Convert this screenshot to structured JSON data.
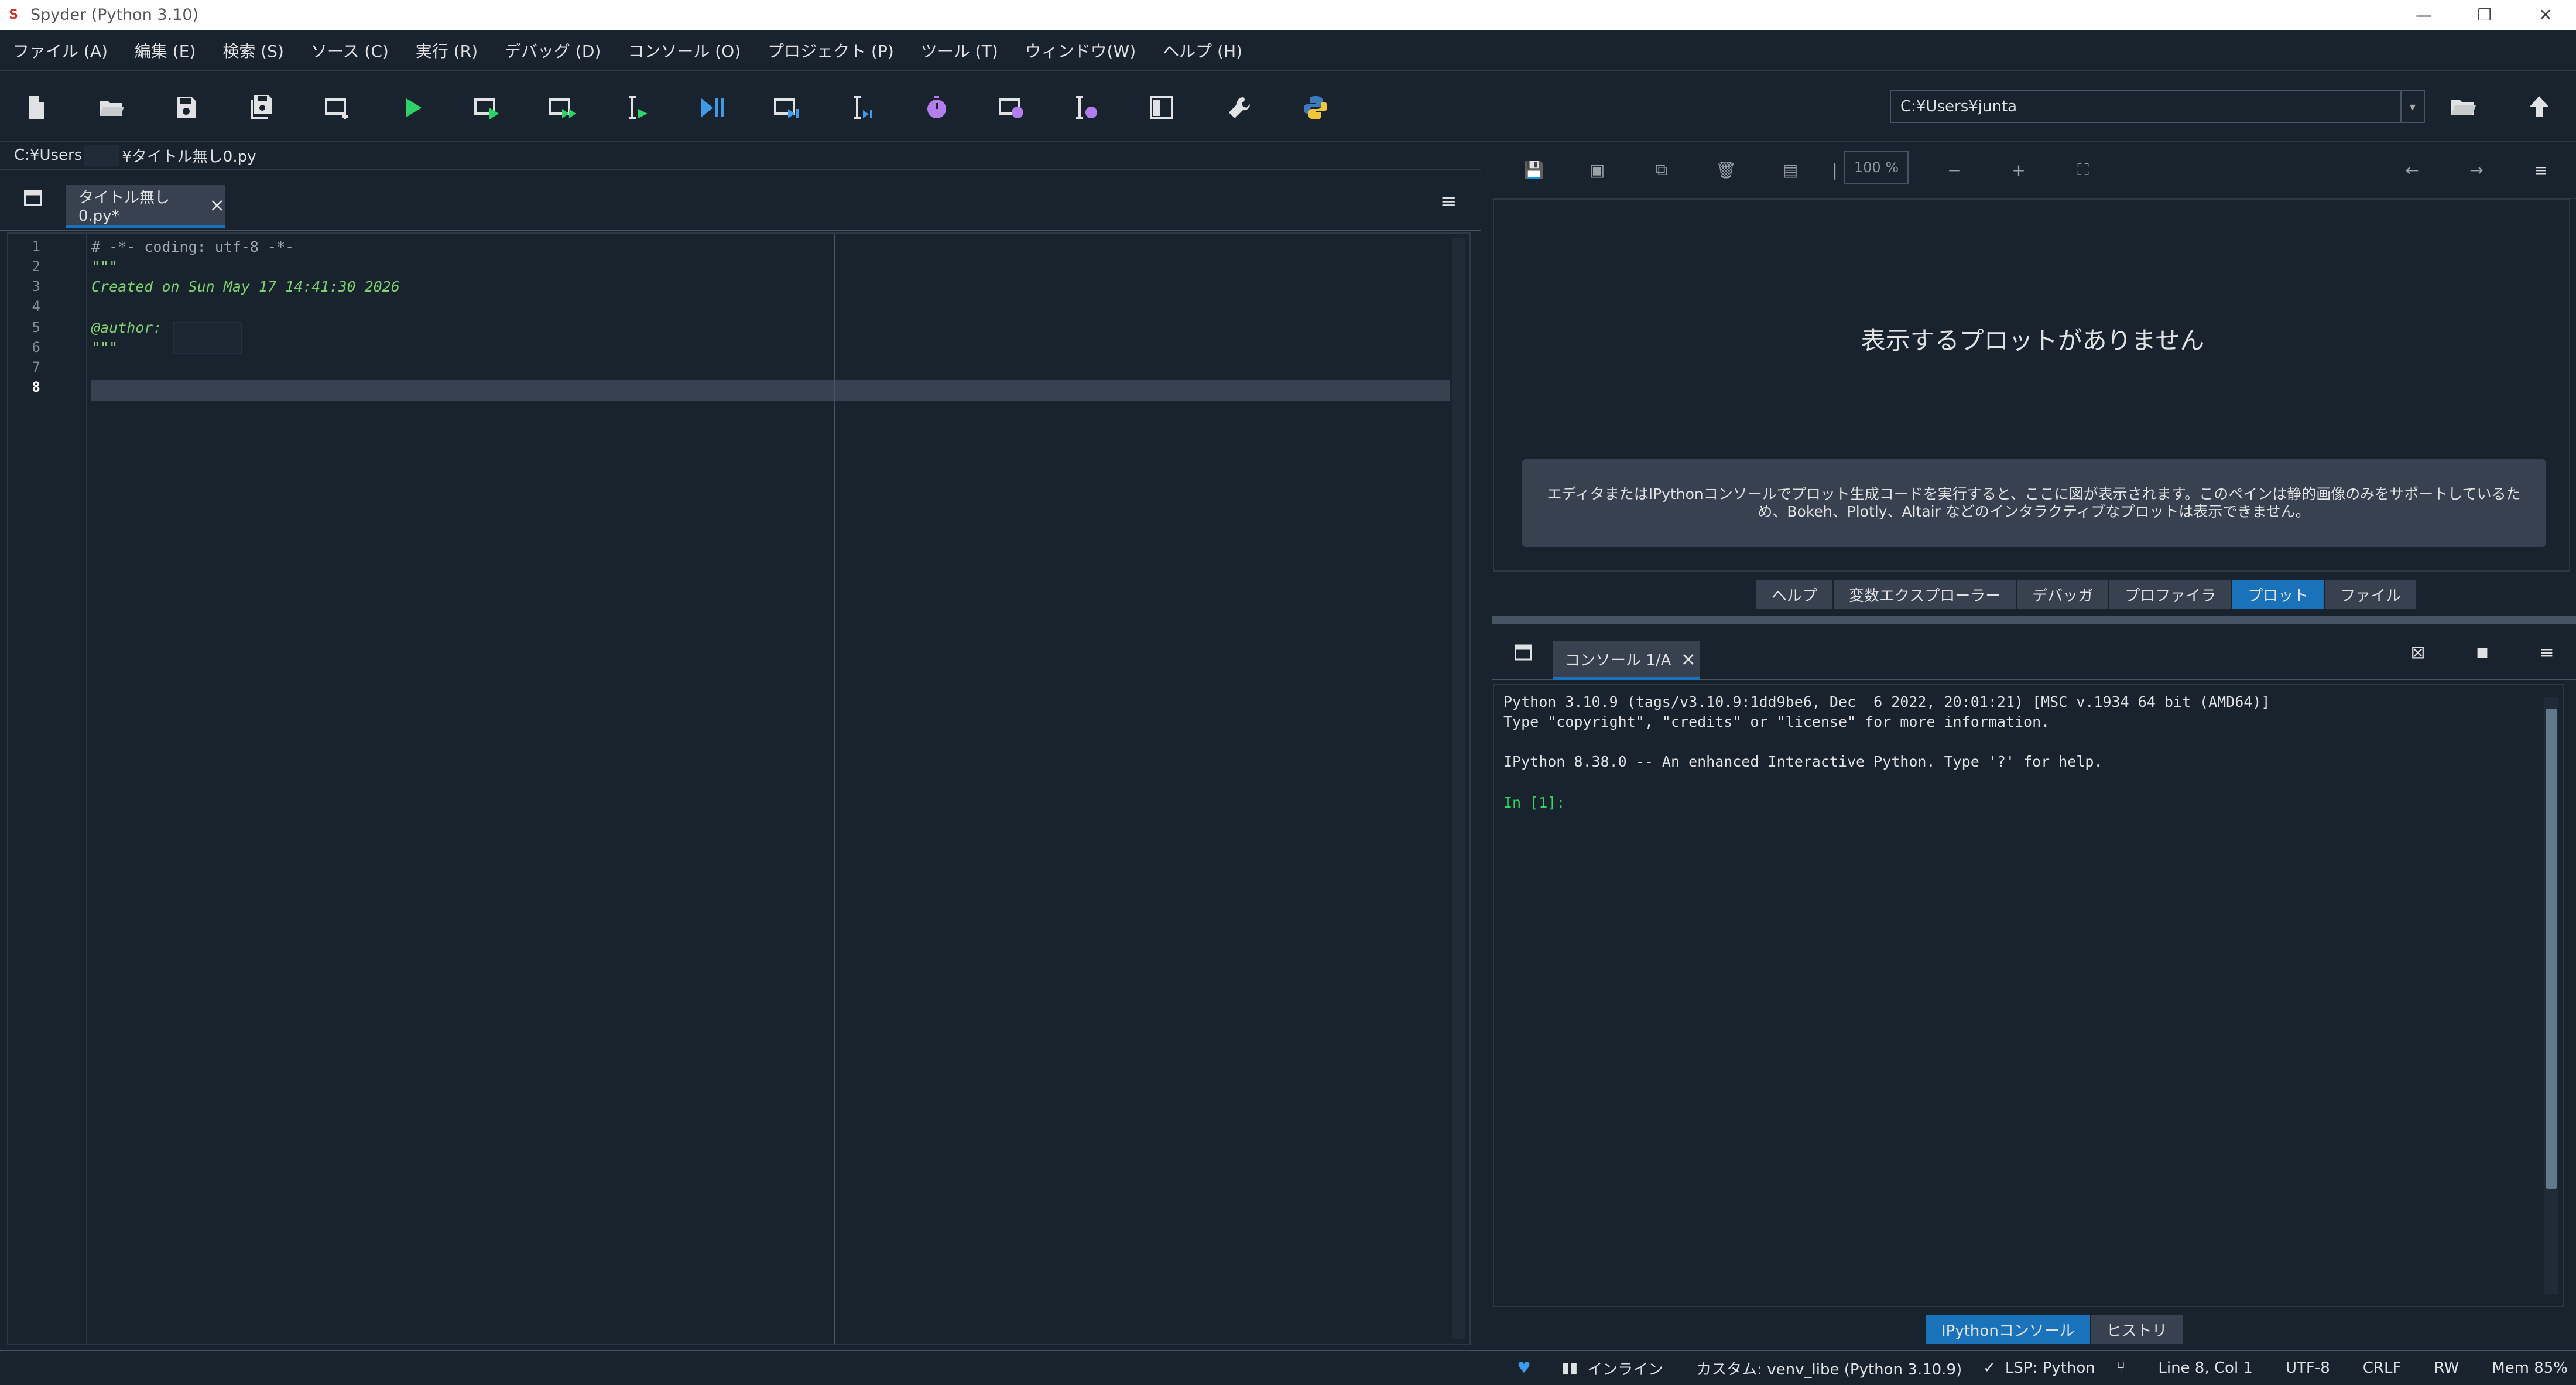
{
  "window": {
    "title": "Spyder (Python 3.10)",
    "app_icon": "spyder-icon"
  },
  "menu": [
    "ファイル (A)",
    "編集 (E)",
    "検索 (S)",
    "ソース (C)",
    "実行 (R)",
    "デバッグ (D)",
    "コンソール (O)",
    "プロジェクト (P)",
    "ツール (T)",
    "ウィンドウ(W)",
    "ヘルプ (H)"
  ],
  "toolbar": {
    "working_dir": "C:¥Users¥junta",
    "icons": [
      "new-file-icon",
      "open-file-icon",
      "save-icon",
      "save-all-icon",
      "new-cell-icon",
      "run-icon",
      "run-cell-icon",
      "run-cell-advance-icon",
      "run-selection-icon",
      "debug-icon",
      "debug-cell-icon",
      "debug-selection-icon",
      "profile-icon",
      "profile-cell-icon",
      "profile-selection-icon",
      "maximize-pane-icon",
      "preferences-icon",
      "python-path-icon"
    ]
  },
  "editor": {
    "breadcrumb_left": "C:¥Users",
    "breadcrumb_right": "¥タイトル無し0.py",
    "tab_label": "タイトル無し0.py*",
    "lines": [
      {
        "num": "1",
        "text": "# -*- coding: utf-8 -*-"
      },
      {
        "num": "2",
        "text": "\"\"\""
      },
      {
        "num": "3",
        "text": "Created on Sun May 17 14:41:30 2026"
      },
      {
        "num": "4",
        "text": ""
      },
      {
        "num": "5",
        "text": "@author:"
      },
      {
        "num": "6",
        "text": "\"\"\""
      },
      {
        "num": "7",
        "text": ""
      },
      {
        "num": "8",
        "text": ""
      }
    ]
  },
  "plots": {
    "zoom": "100 %",
    "empty_title": "表示するプロットがありません",
    "hint": "エディタまたはIPythonコンソールでプロット生成コードを実行すると、ここに図が表示されます。このペインは静的画像のみをサポートしているため、Bokeh、Plotly、Altair などのインタラクティブなプロットは表示できません。",
    "tabs": [
      "ヘルプ",
      "変数エクスプローラー",
      "デバッガ",
      "プロファイラ",
      "プロット",
      "ファイル"
    ],
    "active_tab": "プロット"
  },
  "console": {
    "tab_label": "コンソール 1/A",
    "lines": [
      "Python 3.10.9 (tags/v3.10.9:1dd9be6, Dec  6 2022, 20:01:21) [MSC v.1934 64 bit (AMD64)]",
      "Type \"copyright\", \"credits\" or \"license\" for more information.",
      "",
      "IPython 8.38.0 -- An enhanced Interactive Python. Type '?' for help.",
      "",
      "In [1]:"
    ],
    "tabs": [
      "IPythonコンソール",
      "ヒストリ"
    ],
    "active_tab": "IPythonコンソール"
  },
  "status": {
    "inline": "インライン",
    "env": "カスタム: venv_libe (Python 3.10.9)",
    "lsp": "LSP: Python",
    "cursor": "Line 8, Col 1",
    "encoding": "UTF-8",
    "eol": "CRLF",
    "rw": "RW",
    "mem": "Mem 85%"
  },
  "colors": {
    "background": "#19232d",
    "accent": "#1a72bb",
    "prompt": "#31d85f",
    "docstring": "#7fd170"
  }
}
